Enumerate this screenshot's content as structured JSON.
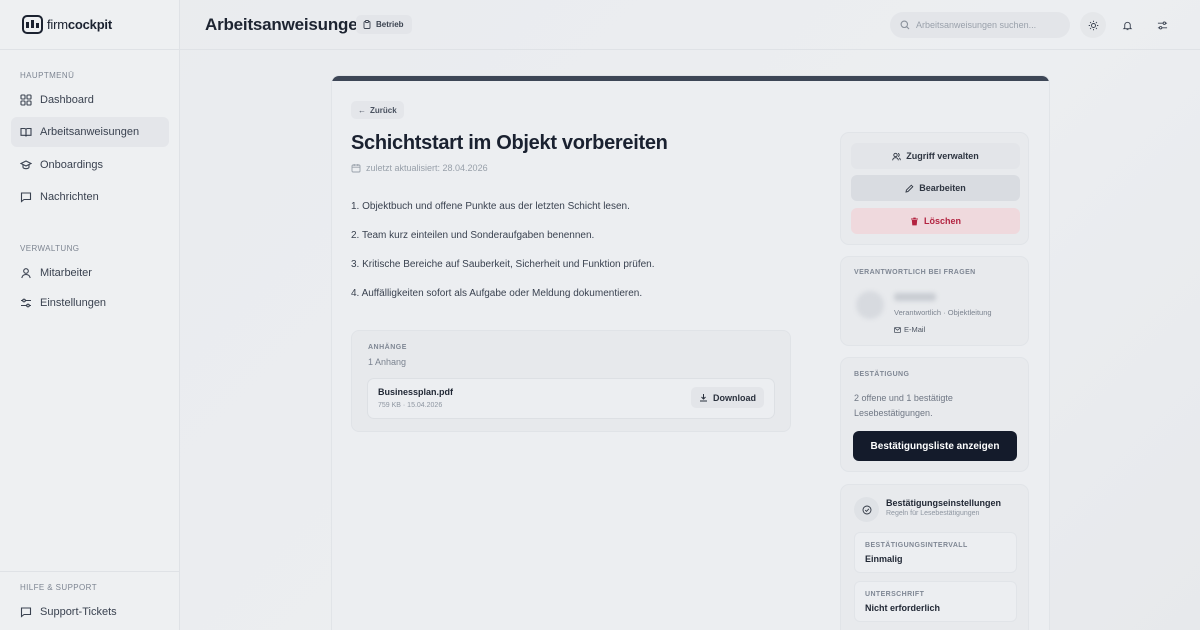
{
  "brand": {
    "name_light": "firm",
    "name_bold": "cockpit"
  },
  "sidebar": {
    "section_main": "HAUPTMENÜ",
    "main_items": [
      {
        "label": "Dashboard",
        "icon": "grid-icon"
      },
      {
        "label": "Arbeitsanweisungen",
        "icon": "book-icon",
        "active": true
      },
      {
        "label": "Onboardings",
        "icon": "graduation-cap-icon"
      },
      {
        "label": "Nachrichten",
        "icon": "chat-icon"
      }
    ],
    "section_admin": "VERWALTUNG",
    "admin_items": [
      {
        "label": "Mitarbeiter",
        "icon": "user-icon"
      },
      {
        "label": "Einstellungen",
        "icon": "sliders-icon"
      }
    ],
    "section_support": "HILFE & SUPPORT",
    "support_items": [
      {
        "label": "Support-Tickets",
        "icon": "chat-icon"
      }
    ]
  },
  "header": {
    "title": "Arbeitsanweisungen",
    "badge": "Betrieb",
    "search_placeholder": "Arbeitsanweisungen suchen..."
  },
  "document": {
    "back_label": "Zurück",
    "title": "Schichtstart im Objekt vorbereiten",
    "updated": "zuletzt aktualisiert: 28.04.2026",
    "steps": [
      "1. Objektbuch und offene Punkte aus der letzten Schicht lesen.",
      "2. Team kurz einteilen und Sonderaufgaben benennen.",
      "3. Kritische Bereiche auf Sauberkeit, Sicherheit und Funktion prüfen.",
      "4. Auffälligkeiten sofort als Aufgabe oder Meldung dokumentieren."
    ],
    "attachments": {
      "label": "ANHÄNGE",
      "count": "1 Anhang",
      "files": [
        {
          "name": "Businessplan.pdf",
          "meta": "759 KB · 15.04.2026",
          "download_label": "Download"
        }
      ]
    }
  },
  "actions": {
    "access_label": "Zugriff verwalten",
    "edit_label": "Bearbeiten",
    "delete_label": "Löschen"
  },
  "responsible": {
    "label": "VERANTWORTLICH BEI FRAGEN",
    "role": "Verantwortlich · Objektleitung",
    "email_label": "E-Mail"
  },
  "confirmation": {
    "label": "BESTÄTIGUNG",
    "text": "2 offene und 1 bestätigte Lesebestätigungen.",
    "button_label": "Bestätigungsliste anzeigen"
  },
  "confirmation_settings": {
    "title": "Bestätigungseinstellungen",
    "subtitle": "Regeln für Lesebestätigungen",
    "interval_label": "BESTÄTIGUNGSINTERVALL",
    "interval_value": "Einmalig",
    "signature_label": "UNTERSCHRIFT",
    "signature_value": "Nicht erforderlich"
  },
  "colors": {
    "primary_button": "#141b2b",
    "delete_text": "#b32340",
    "delete_bg": "#efd9dd",
    "card_topbar": "#3d4656"
  }
}
